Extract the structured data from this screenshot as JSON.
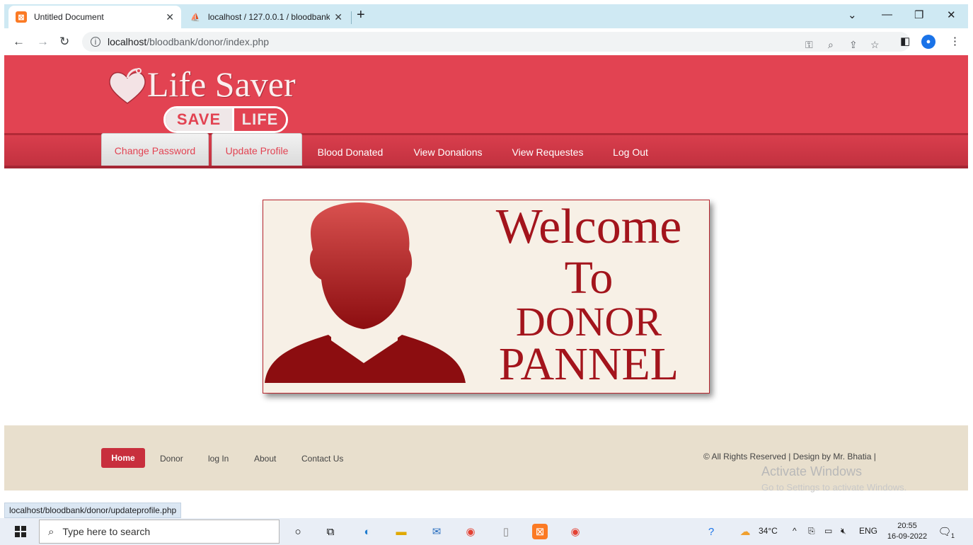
{
  "browser": {
    "tabs": [
      {
        "title": "Untitled Document",
        "favicon": "xampp-icon"
      },
      {
        "title": "localhost / 127.0.0.1 / bloodbank",
        "favicon": "phpmyadmin-icon"
      }
    ],
    "url_host": "localhost",
    "url_path": "/bloodbank/donor/index.php",
    "status_url": "localhost/bloodbank/donor/updateprofile.php"
  },
  "site": {
    "logo_title": "Life Saver",
    "logo_badge_left": "SAVE",
    "logo_badge_right": "LIFE",
    "nav": [
      {
        "label": "Change Password"
      },
      {
        "label": "Update Profile"
      },
      {
        "label": "Blood Donated"
      },
      {
        "label": "View Donations"
      },
      {
        "label": "View Requestes"
      },
      {
        "label": "Log Out"
      }
    ],
    "banner": {
      "line1": "Welcome",
      "line2": "To",
      "line3": "DONOR",
      "line4": "PANNEL"
    },
    "footer": {
      "links": [
        {
          "label": "Home"
        },
        {
          "label": "Donor"
        },
        {
          "label": "log In"
        },
        {
          "label": "About"
        },
        {
          "label": "Contact Us"
        }
      ],
      "copyright": "© All Rights Reserved | Design by Mr. Bhatia |"
    }
  },
  "watermark": {
    "line1": "Activate Windows",
    "line2": "Go to Settings to activate Windows."
  },
  "taskbar": {
    "search_placeholder": "Type here to search",
    "temperature": "34°C",
    "language": "ENG",
    "time": "20:55",
    "date": "16-09-2022",
    "notification_count": "1"
  },
  "colors": {
    "header": "#e24352",
    "nav": "#c0303e",
    "banner_text": "#a3141c",
    "footer": "#e8dfcd"
  }
}
